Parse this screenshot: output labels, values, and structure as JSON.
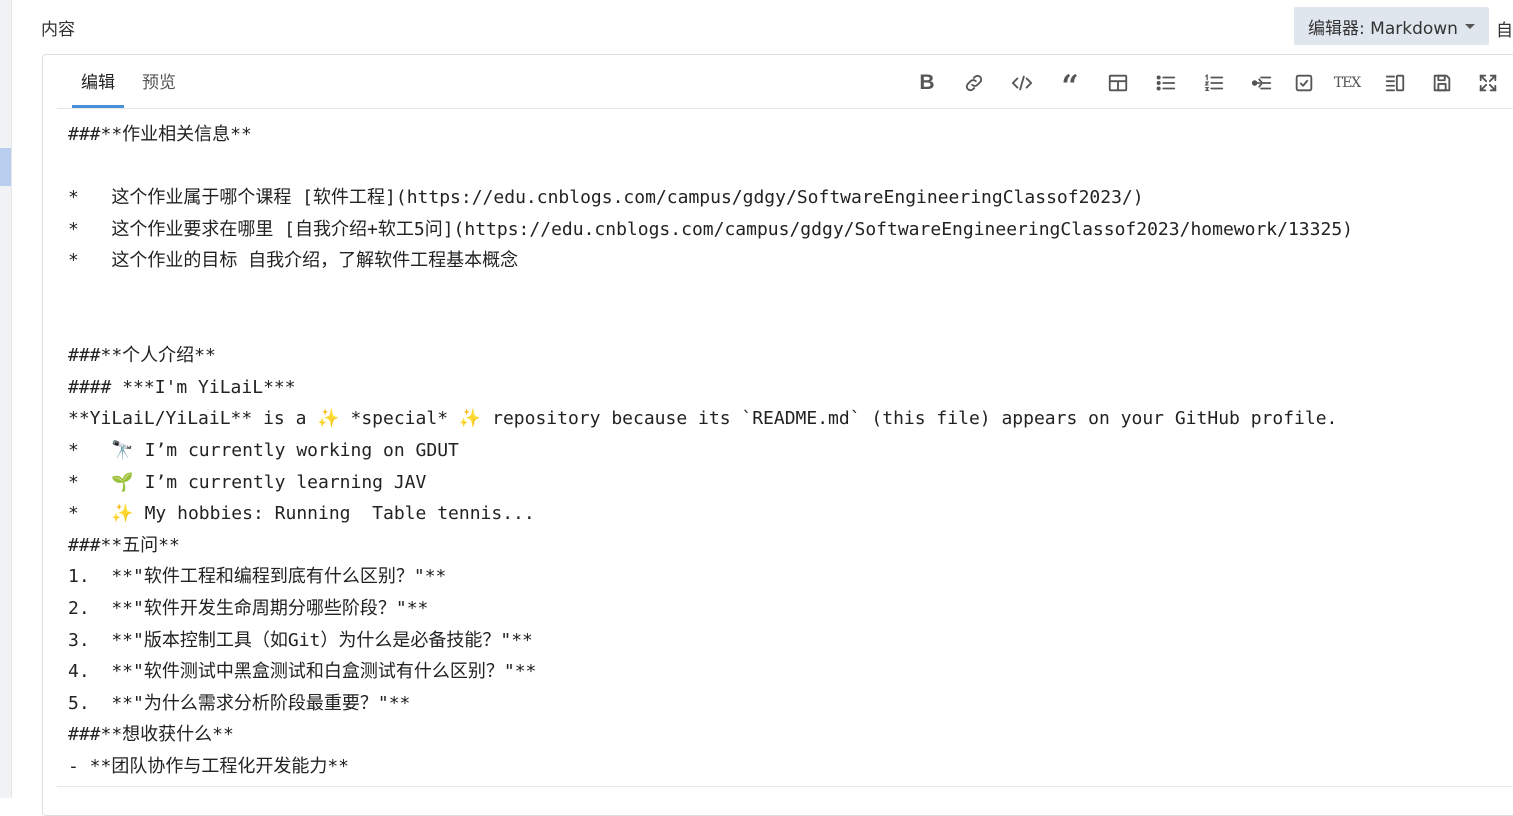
{
  "section": {
    "label": "内容"
  },
  "editor": {
    "select_label": "编辑器: Markdown",
    "auto_label": "自"
  },
  "tabs": [
    {
      "label": "编辑"
    },
    {
      "label": "预览"
    }
  ],
  "toolbar": {
    "icons": [
      "bold-icon",
      "link-icon",
      "code-icon",
      "quote-icon",
      "table-icon",
      "unordered-list-icon",
      "ordered-list-icon",
      "indent-icon",
      "checkbox-icon",
      "tex-icon",
      "split-view-icon",
      "save-icon",
      "fullscreen-icon"
    ],
    "bold_glyph": "B",
    "quote_glyph": "“",
    "tex_glyph": "TEX"
  },
  "content": {
    "lines": [
      "###**作业相关信息**",
      "",
      "*   这个作业属于哪个课程 [软件工程](https://edu.cnblogs.com/campus/gdgy/SoftwareEngineeringClassof2023/)",
      "*   这个作业要求在哪里 [自我介绍+软工5问](https://edu.cnblogs.com/campus/gdgy/SoftwareEngineeringClassof2023/homework/13325)",
      "*   这个作业的目标 自我介绍，了解软件工程基本概念",
      "",
      "",
      "###**个人介绍**",
      "#### ***I'm YiLaiL***",
      "**YiLaiL/YiLaiL** is a ✨ *special* ✨ repository because its `README.md` (this file) appears on your GitHub profile.",
      "*   🔭 I’m currently working on GDUT",
      "*   🌱 I’m currently learning JAV",
      "*   ✨ My hobbies: Running  Table tennis...",
      "###**五问**",
      "1.  **\"软件工程和编程到底有什么区别？\"**",
      "2.  **\"软件开发生命周期分哪些阶段？\"**",
      "3.  **\"版本控制工具（如Git）为什么是必备技能？\"**",
      "4.  **\"软件测试中黑盒测试和白盒测试有什么区别？\"**",
      "5.  **\"为什么需求分析阶段最重要？\"**",
      "###**想收获什么**",
      "- **团队协作与工程化开发能力**"
    ]
  }
}
